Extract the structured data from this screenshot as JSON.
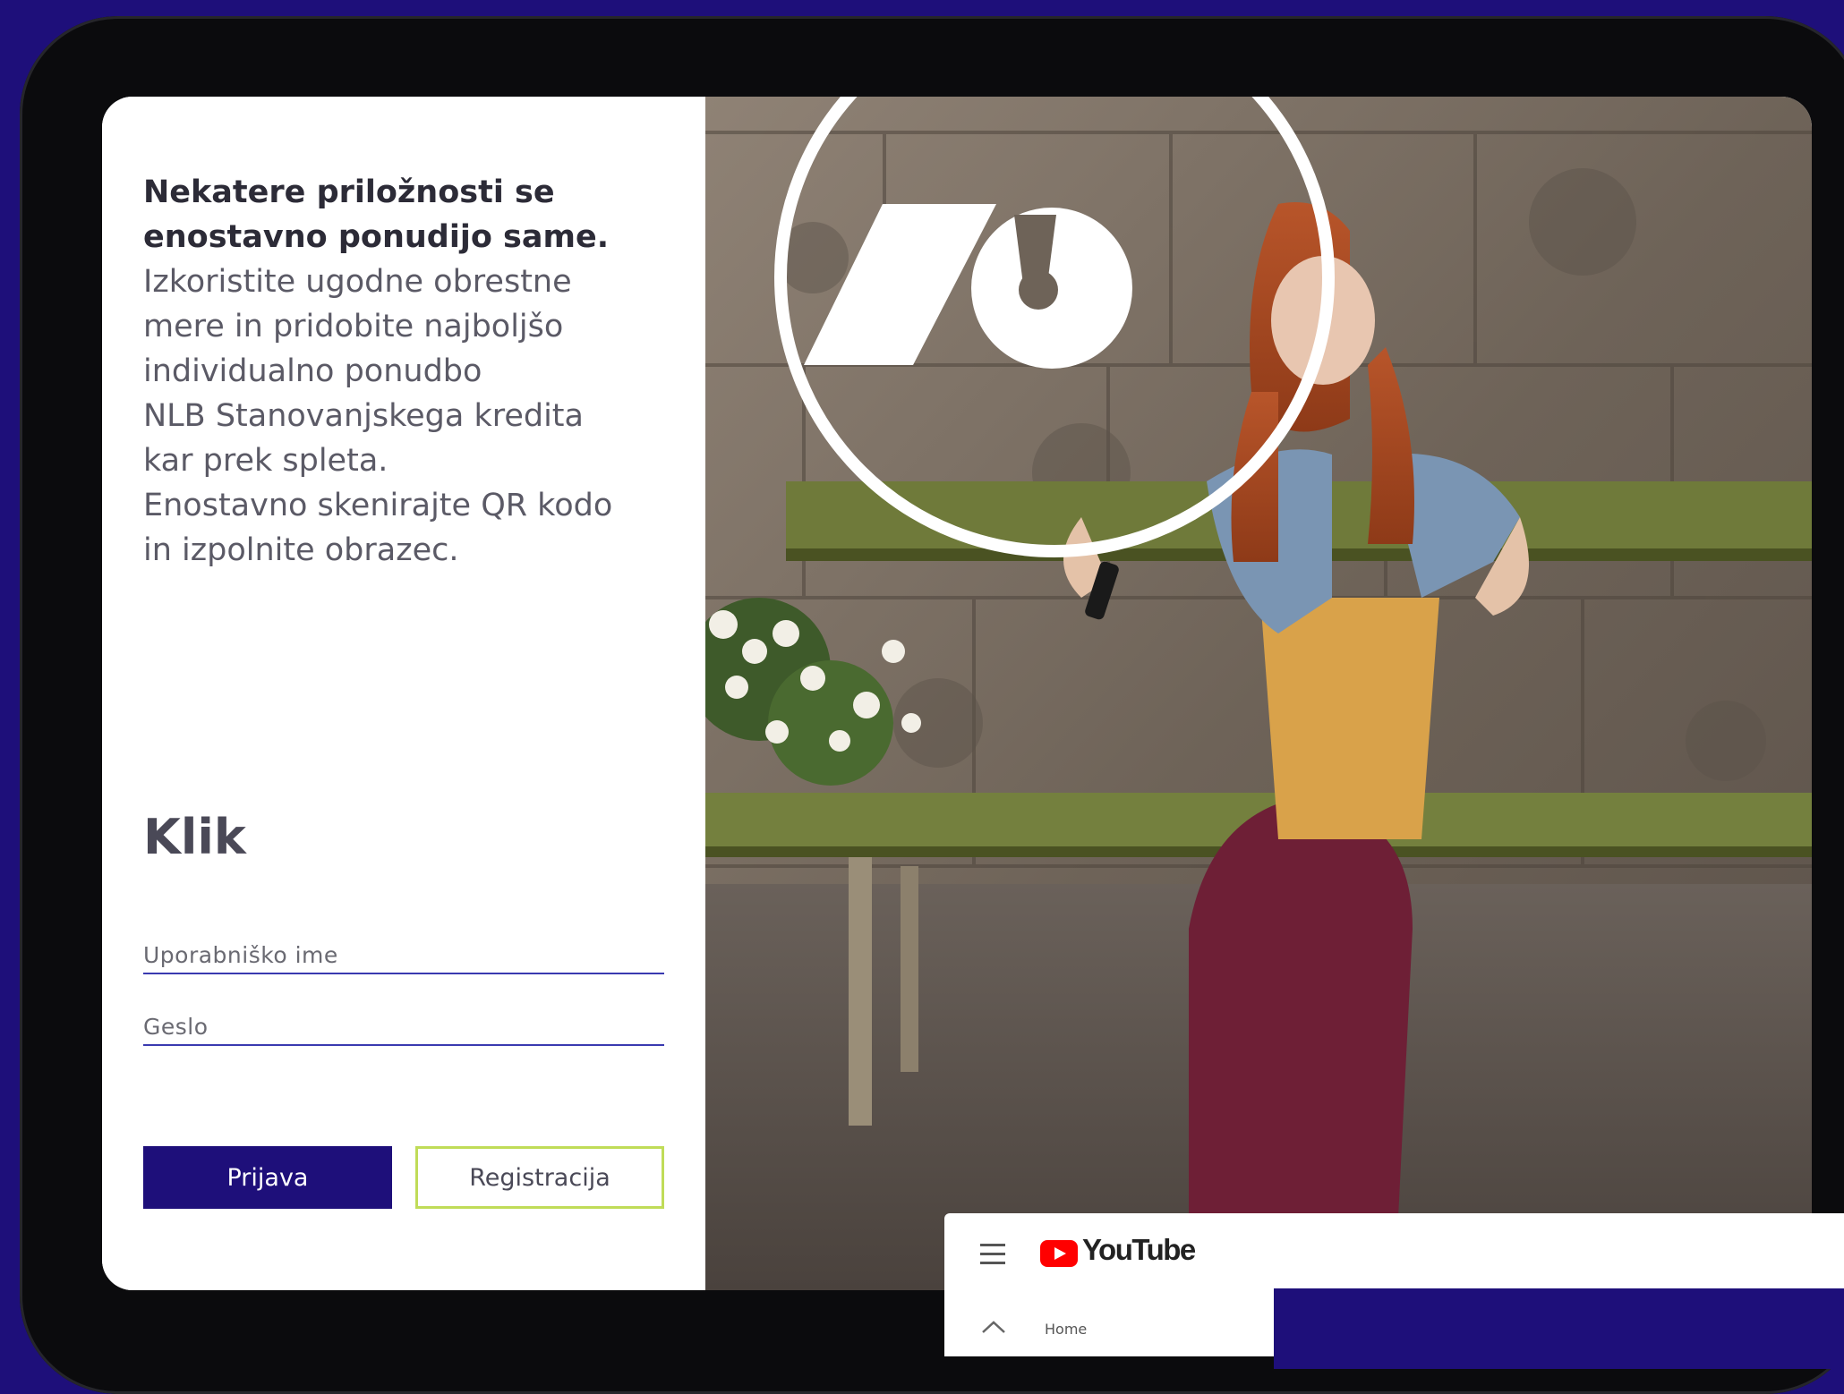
{
  "promo": {
    "headline_lines": [
      "Nekatere priložnosti se",
      "enostavno ponudijo same."
    ],
    "body_lines": [
      "Izkoristite ugodne obrestne",
      "mere in pridobite najboljšo",
      "individualno ponudbo",
      "NLB Stanovanjskega kredita",
      "kar prek spleta.",
      "Enostavno skenirajte QR kodo",
      "in izpolnite obrazec."
    ]
  },
  "brand": "Klik",
  "form": {
    "username_placeholder": "Uporabniško ime",
    "password_placeholder": "Geslo",
    "login_label": "Prijava",
    "register_label": "Registracija"
  },
  "overlay": {
    "app_name": "YouTube",
    "nav_home": "Home"
  },
  "colors": {
    "brand_purple": "#1e0f7a",
    "accent_lime": "#c0dc58",
    "background": "#1e0f7a",
    "device_frame": "#0b0b0d"
  },
  "icons": [
    "menu-icon",
    "youtube-logo-icon",
    "home-icon",
    "nlb-logo-icon"
  ]
}
